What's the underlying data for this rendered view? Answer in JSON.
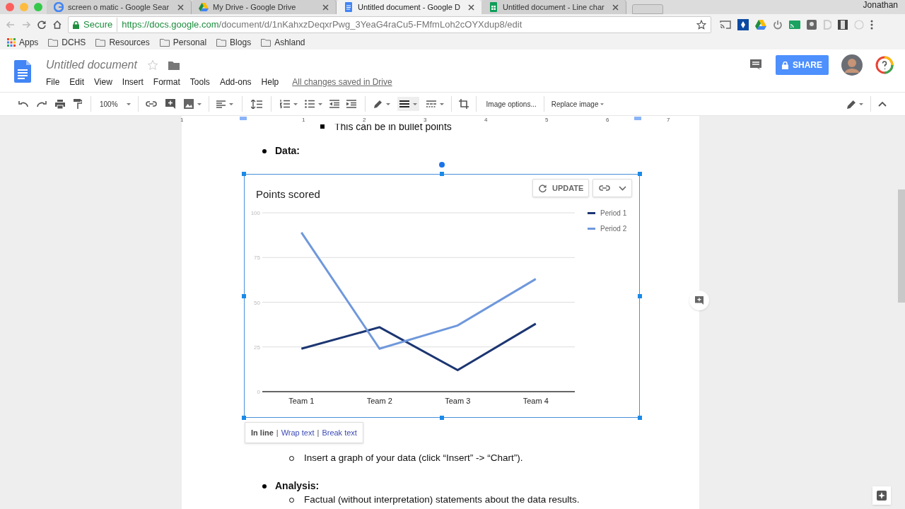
{
  "browser": {
    "tabs": [
      {
        "title": "screen o matic - Google Sear",
        "kind": "google",
        "selected": false
      },
      {
        "title": "My Drive - Google Drive",
        "kind": "drive",
        "selected": false
      },
      {
        "title": "Untitled document - Google D",
        "kind": "docs",
        "selected": true
      },
      {
        "title": "Untitled document - Line char",
        "kind": "sheets",
        "selected": false
      }
    ],
    "profile": "Jonathan",
    "secure_label": "Secure",
    "url_host": "https://docs.google.com",
    "url_path": "/document/d/1nKahxzDeqxrPwg_3YeaG4raCu5-FMfmLoh2cOYXdup8/edit",
    "bookmarks": [
      {
        "label": "Apps",
        "kind": "apps"
      },
      {
        "label": "DCHS",
        "kind": "folder"
      },
      {
        "label": "Resources",
        "kind": "folder"
      },
      {
        "label": "Personal",
        "kind": "folder"
      },
      {
        "label": "Blogs",
        "kind": "folder"
      },
      {
        "label": "Ashland",
        "kind": "folder"
      }
    ]
  },
  "docs": {
    "title": "Untitled document",
    "menu": [
      "File",
      "Edit",
      "View",
      "Insert",
      "Format",
      "Tools",
      "Add-ons",
      "Help"
    ],
    "save_status": "All changes saved in Drive",
    "share": "SHARE",
    "zoom": "100%",
    "image_options": "Image options...",
    "replace_image": "Replace image",
    "ruler": [
      "1",
      "1",
      "2",
      "3",
      "4",
      "5",
      "6",
      "7"
    ]
  },
  "document": {
    "top_bullet": "This can be in bullet points",
    "data_heading": "Data:",
    "chart": {
      "update": "UPDATE",
      "chart_data": {
        "type": "line",
        "title": "Points scored",
        "categories": [
          "Team 1",
          "Team 2",
          "Team 3",
          "Team 4"
        ],
        "series": [
          {
            "name": "Period 1",
            "color": "#1c3672",
            "values": [
              24,
              36,
              12,
              38
            ]
          },
          {
            "name": "Period 2",
            "color": "#6f98dc",
            "values": [
              89,
              24,
              37,
              63
            ]
          }
        ],
        "ylim": [
          0,
          100
        ],
        "yticks": [
          0,
          25,
          50,
          75,
          100
        ],
        "grid": true,
        "legend": true
      }
    },
    "wrap_separator": "|",
    "wrap_options": [
      {
        "label": "In line",
        "selected": true
      },
      {
        "label": "Wrap text",
        "selected": false
      },
      {
        "label": "Break text",
        "selected": false
      }
    ],
    "graph_item": "Insert a graph of your data (click “Insert” -> “Chart”).",
    "analysis_heading": "Analysis:",
    "analysis_item": "Factual (without interpretation) statements about the data results."
  }
}
